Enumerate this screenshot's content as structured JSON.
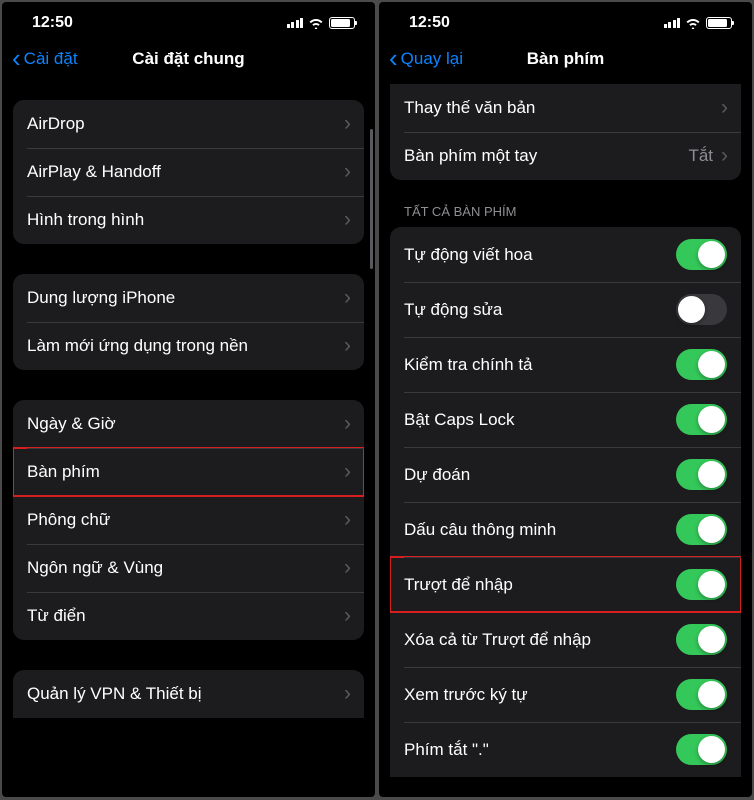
{
  "status": {
    "time": "12:50"
  },
  "left": {
    "back_label": "Cài đặt",
    "title": "Cài đặt chung",
    "groups": [
      {
        "items": [
          {
            "label": "AirDrop",
            "type": "nav"
          },
          {
            "label": "AirPlay & Handoff",
            "type": "nav"
          },
          {
            "label": "Hình trong hình",
            "type": "nav"
          }
        ]
      },
      {
        "items": [
          {
            "label": "Dung lượng iPhone",
            "type": "nav"
          },
          {
            "label": "Làm mới ứng dụng trong nền",
            "type": "nav"
          }
        ]
      },
      {
        "items": [
          {
            "label": "Ngày & Giờ",
            "type": "nav"
          },
          {
            "label": "Bàn phím",
            "type": "nav",
            "highlight": true
          },
          {
            "label": "Phông chữ",
            "type": "nav"
          },
          {
            "label": "Ngôn ngữ & Vùng",
            "type": "nav"
          },
          {
            "label": "Từ điển",
            "type": "nav"
          }
        ]
      },
      {
        "items": [
          {
            "label": "Quản lý VPN & Thiết bị",
            "type": "nav"
          }
        ]
      }
    ]
  },
  "right": {
    "back_label": "Quay lại",
    "title": "Bàn phím",
    "section_header": "Tất cả bàn phím",
    "groups": [
      {
        "items": [
          {
            "label": "Thay thế văn bản",
            "type": "nav"
          },
          {
            "label": "Bàn phím một tay",
            "type": "value",
            "value": "Tắt"
          }
        ]
      },
      {
        "header": "Tất cả bàn phím",
        "items": [
          {
            "label": "Tự động viết hoa",
            "type": "toggle",
            "on": true
          },
          {
            "label": "Tự động sửa",
            "type": "toggle",
            "on": false
          },
          {
            "label": "Kiểm tra chính tả",
            "type": "toggle",
            "on": true
          },
          {
            "label": "Bật Caps Lock",
            "type": "toggle",
            "on": true
          },
          {
            "label": "Dự đoán",
            "type": "toggle",
            "on": true
          },
          {
            "label": "Dấu câu thông minh",
            "type": "toggle",
            "on": true
          },
          {
            "label": "Trượt để nhập",
            "type": "toggle",
            "on": true,
            "highlight": true
          },
          {
            "label": "Xóa cả từ Trượt để nhập",
            "type": "toggle",
            "on": true
          },
          {
            "label": "Xem trước ký tự",
            "type": "toggle",
            "on": true
          },
          {
            "label": "Phím tắt \".\"",
            "type": "toggle",
            "on": true
          }
        ]
      }
    ]
  }
}
